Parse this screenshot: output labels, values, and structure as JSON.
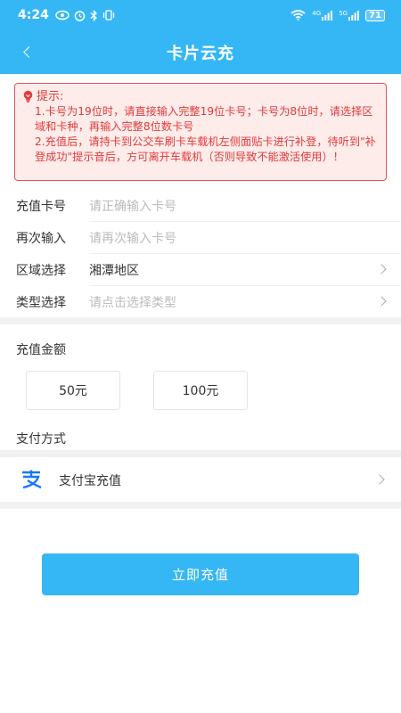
{
  "status_bar": {
    "time": "4:24",
    "left_icons": [
      "eye-icon",
      "alarm-icon",
      "bluetooth-icon",
      "vibrate-icon"
    ],
    "right_icons": [
      "wifi-icon",
      "signal-4g-icon",
      "signal-5g-icon"
    ],
    "signal_labels": [
      "4G",
      "5G"
    ],
    "battery": "71"
  },
  "nav": {
    "title": "卡片云充"
  },
  "notice": {
    "title": "提示:",
    "line1": "1.卡号为19位时，请直接输入完整19位卡号；卡号为8位时，请选择区域和卡种，再输入完整8位数卡号",
    "line2": "2.充值后，请持卡到公交车刷卡车载机左侧面贴卡进行补登，待听到\"补登成功\"提示音后，方可离开车载机（否则导致不能激活使用）！"
  },
  "form": {
    "card_number": {
      "label": "充值卡号",
      "placeholder": "请正确输入卡号"
    },
    "confirm_number": {
      "label": "再次输入",
      "placeholder": "请再次输入卡号"
    },
    "region": {
      "label": "区域选择",
      "value": "湘潭地区"
    },
    "type": {
      "label": "类型选择",
      "placeholder": "请点击选择类型"
    }
  },
  "amount": {
    "label": "充值金额",
    "options": [
      "50元",
      "100元"
    ]
  },
  "payment": {
    "label": "支付方式",
    "alipay_label": "支付宝充值"
  },
  "submit_label": "立即充值",
  "colors": {
    "brand": "#36b7f5",
    "notice_text": "#e03b3b",
    "notice_bg": "#fdecea",
    "alipay": "#1677ff"
  }
}
